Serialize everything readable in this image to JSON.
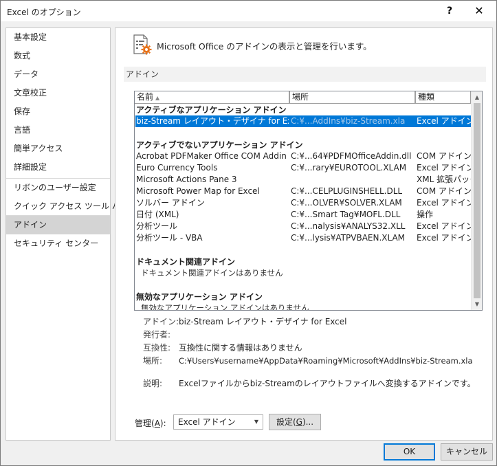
{
  "window": {
    "title": "Excel のオプション",
    "help": "?",
    "close": "✕"
  },
  "nav": {
    "items": [
      "基本設定",
      "数式",
      "データ",
      "文章校正",
      "保存",
      "言語",
      "簡単アクセス",
      "詳細設定",
      "リボンのユーザー設定",
      "クイック アクセス ツール バー",
      "アドイン",
      "セキュリティ センター"
    ],
    "selected": "アドイン"
  },
  "header": {
    "text": "Microsoft Office のアドインの表示と管理を行います。",
    "icon": "addin-gear-icon"
  },
  "section": {
    "title": "アドイン"
  },
  "list": {
    "columns": {
      "name": "名前",
      "location": "場所",
      "type": "種類",
      "sort_indicator": "▲"
    },
    "active_group": "アクティブなアプリケーション アドイン",
    "active_rows": [
      {
        "name": "biz-Stream レイアウト・デザイナ for Excel",
        "location": "C:¥...AddIns¥biz-Stream.xla",
        "type": "Excel アドイン"
      }
    ],
    "inactive_group": "アクティブでないアプリケーション アドイン",
    "inactive_rows": [
      {
        "name": "Acrobat PDFMaker Office COM Addin",
        "location": "C:¥...64¥PDFMOfficeAddin.dll",
        "type": "COM アドイン"
      },
      {
        "name": "Euro Currency Tools",
        "location": "C:¥...rary¥EUROTOOL.XLAM",
        "type": "Excel アドイン"
      },
      {
        "name": "Microsoft Actions Pane 3",
        "location": "",
        "type": "XML 拡張パック"
      },
      {
        "name": "Microsoft Power Map for Excel",
        "location": "C:¥...CELPLUGINSHELL.DLL",
        "type": "COM アドイン"
      },
      {
        "name": "ソルバー アドイン",
        "location": "C:¥...OLVER¥SOLVER.XLAM",
        "type": "Excel アドイン"
      },
      {
        "name": "日付 (XML)",
        "location": "C:¥...Smart Tag¥MOFL.DLL",
        "type": "操作"
      },
      {
        "name": "分析ツール",
        "location": "C:¥...nalysis¥ANALYS32.XLL",
        "type": "Excel アドイン"
      },
      {
        "name": "分析ツール - VBA",
        "location": "C:¥...lysis¥ATPVBAEN.XLAM",
        "type": "Excel アドイン"
      }
    ],
    "document_group": "ドキュメント関連アドイン",
    "document_empty": "ドキュメント関連アドインはありません",
    "disabled_group": "無効なアプリケーション アドイン",
    "disabled_empty": "無効なアプリケーション アドインはありません"
  },
  "details": {
    "addin_label": "アドイン:",
    "addin_value": "biz-Stream レイアウト・デザイナ for Excel",
    "publisher_label": "発行者:",
    "publisher_value": "",
    "compat_label": "互換性:",
    "compat_value": "互換性に関する情報はありません",
    "location_label": "場所:",
    "location_value": "C:¥Users¥username¥AppData¥Roaming¥Microsoft¥AddIns¥biz-Stream.xla",
    "description_label": "説明:",
    "description_value": "Excelファイルからbiz-Streamのレイアウトファイルへ変換するアドインです。"
  },
  "manage": {
    "label_prefix": "管理(",
    "label_key": "A",
    "label_suffix": "):",
    "selected": "Excel アドイン",
    "go_prefix": "設定(",
    "go_key": "G",
    "go_suffix": ")..."
  },
  "buttons": {
    "ok": "OK",
    "cancel": "キャンセル"
  },
  "colors": {
    "selection": "#0078d7",
    "nav_selected": "#d4d4d4",
    "accent_icon": "#e8731a"
  }
}
